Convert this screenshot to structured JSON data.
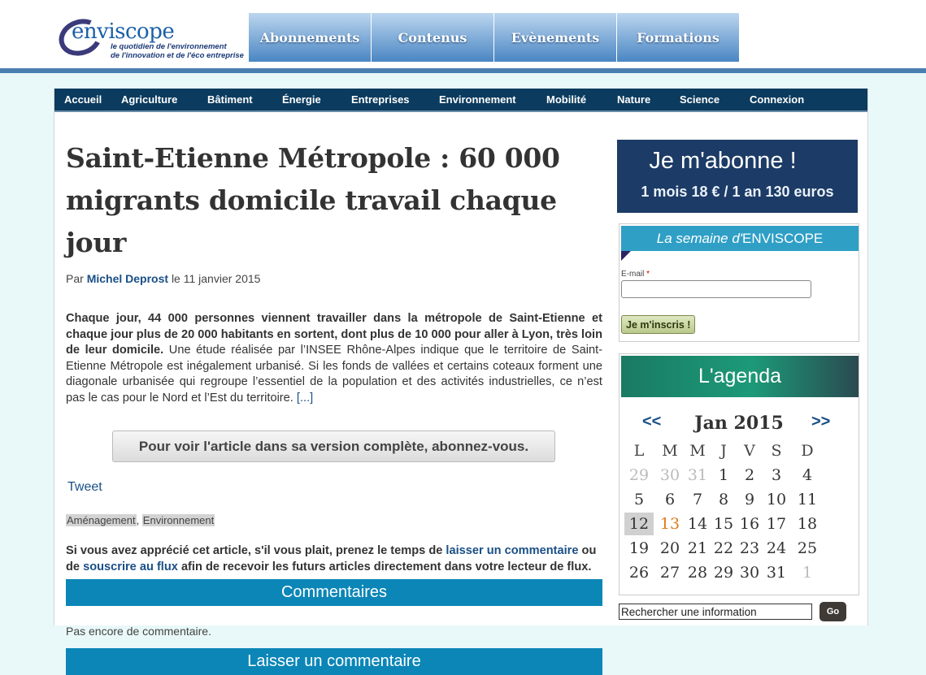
{
  "brand": {
    "logo_text": "enviscope",
    "tagline_1": "le quotidien de l'environnement",
    "tagline_2": "de l'innovation et de l'éco entreprise"
  },
  "topnav": [
    "Abonnements",
    "Contenus",
    "Evènements",
    "Formations"
  ],
  "categories": [
    "Accueil",
    "Agriculture",
    "Bâtiment",
    "Énergie",
    "Entreprises",
    "Environnement",
    "Mobilité",
    "Nature",
    "Science",
    "Connexion"
  ],
  "article": {
    "title": "Saint-Etienne Métropole : 60 000 migrants domicile travail chaque jour",
    "by_prefix": "Par",
    "author": "Michel Deprost",
    "date": "le 11 janvier 2015",
    "lead": "Chaque jour, 44 000 personnes viennent travailler dans la métropole de Saint-Etienne et chaque jour plus de 20 000 habitants en sortent, dont plus de 10 000 pour aller à Lyon, très loin de leur domicile.",
    "body": " Une étude réalisée par l’INSEE Rhône-Alpes indique que le territoire de Saint-Etienne Métropole est inégalement urbanisé. Si les fonds de vallées et certains coteaux forment une diagonale urbanisée qui regroupe l’essentiel de la population et des activités industrielles, ce n’est pas le cas pour le Nord et l’Est du territoire. ",
    "more": "[...]",
    "subscribe_button": "Pour voir l'article dans sa version complète, abonnez-vous.",
    "tweet": "Tweet",
    "tags": [
      "Aménagement",
      "Environnement"
    ],
    "tag_sep": ", ",
    "appreciate_1": "Si vous avez apprécié cet article, s'il vous plait, prenez le temps de ",
    "appreciate_link1": "laisser un commentaire",
    "appreciate_2": " ou de ",
    "appreciate_link2": "souscrire au flux",
    "appreciate_3": " afin de recevoir les futurs articles directement dans votre lecteur de flux.",
    "comments_heading": "Commentaires",
    "no_comment": "Pas encore de commentaire.",
    "leave_comment_heading": "Laisser un commentaire"
  },
  "sidebar": {
    "subscribe_title": "Je m'abonne !",
    "subscribe_price": "1 mois 18 € / 1 an 130 euros",
    "newsletter_title_italic": "La semaine d'",
    "newsletter_title_brand": "ENVISCOPE",
    "email_label": "E-mail",
    "required_mark": "*",
    "signup_button": "Je m'inscris !",
    "agenda_title": "L'agenda",
    "calendar": {
      "prev": "<<",
      "next": ">>",
      "month": "Jan 2015",
      "weekdays": [
        "L",
        "M",
        "M",
        "J",
        "V",
        "S",
        "D"
      ],
      "weeks": [
        [
          {
            "d": "29",
            "out": true
          },
          {
            "d": "30",
            "out": true
          },
          {
            "d": "31",
            "out": true
          },
          {
            "d": "1"
          },
          {
            "d": "2"
          },
          {
            "d": "3"
          },
          {
            "d": "4"
          }
        ],
        [
          {
            "d": "5"
          },
          {
            "d": "6"
          },
          {
            "d": "7"
          },
          {
            "d": "8"
          },
          {
            "d": "9"
          },
          {
            "d": "10"
          },
          {
            "d": "11"
          }
        ],
        [
          {
            "d": "12",
            "today": true
          },
          {
            "d": "13",
            "event": true
          },
          {
            "d": "14"
          },
          {
            "d": "15"
          },
          {
            "d": "16"
          },
          {
            "d": "17"
          },
          {
            "d": "18"
          }
        ],
        [
          {
            "d": "19"
          },
          {
            "d": "20"
          },
          {
            "d": "21"
          },
          {
            "d": "22"
          },
          {
            "d": "23"
          },
          {
            "d": "24"
          },
          {
            "d": "25"
          }
        ],
        [
          {
            "d": "26"
          },
          {
            "d": "27"
          },
          {
            "d": "28"
          },
          {
            "d": "29"
          },
          {
            "d": "30"
          },
          {
            "d": "31"
          },
          {
            "d": "1",
            "out": true
          }
        ]
      ]
    },
    "search_placeholder": "Rechercher une information",
    "search_button": "Go"
  }
}
